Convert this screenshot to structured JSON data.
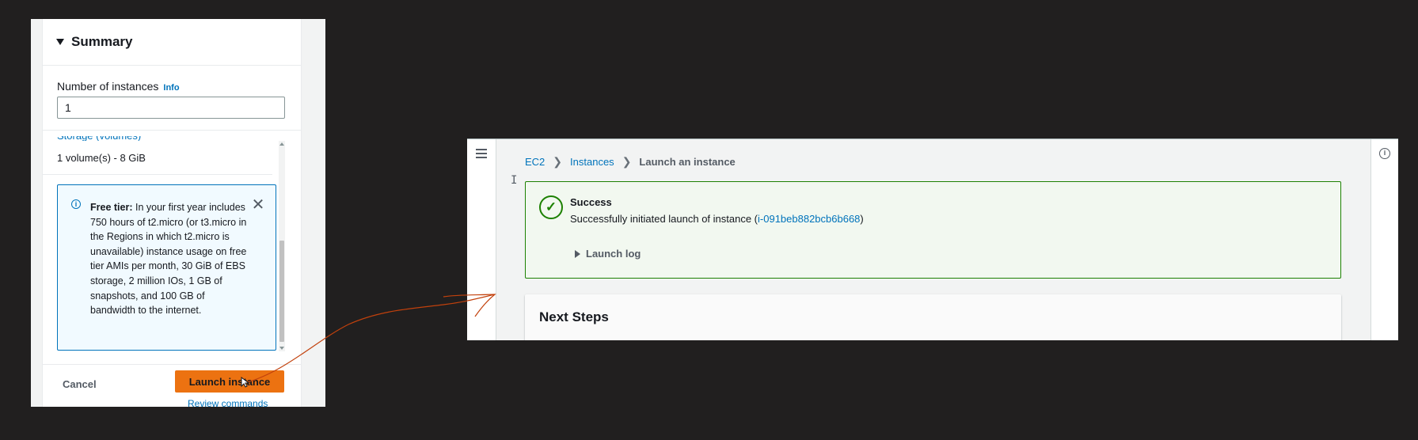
{
  "summary_panel": {
    "title": "Summary",
    "instances_label": "Number of instances",
    "info_link": "Info",
    "instances_value": "1",
    "volume_text": "1 volume(s) - 8 GiB",
    "free_tier_title": "Free tier:",
    "free_tier_body": "In your first year includes 750 hours of t2.micro (or t3.micro in the Regions in which t2.micro is unavailable) instance usage on free tier AMIs per month, 30 GiB of EBS storage, 2 million IOs, 1 GB of snapshots, and 100 GB of bandwidth to the internet.",
    "cancel_label": "Cancel",
    "launch_label": "Launch instance",
    "review_label": "Review commands"
  },
  "ec2_panel": {
    "breadcrumb": {
      "ec2": "EC2",
      "instances": "Instances",
      "current": "Launch an instance"
    },
    "success": {
      "title": "Success",
      "message_prefix": "Successfully initiated launch of instance (",
      "instance_id": "i-091beb882bcb6b668",
      "message_suffix": ")",
      "launch_log_label": "Launch log"
    },
    "next_steps_title": "Next Steps"
  },
  "icons": {
    "success": "check-circle-icon",
    "info": "info-icon",
    "close": "close-icon",
    "menu": "hamburger-menu-icon"
  },
  "colors": {
    "background": "#211f1f",
    "accent_orange": "#ec7211",
    "link_blue": "#0073bb",
    "success_green": "#1d8102",
    "annotation_arrow": "#c2410c"
  }
}
